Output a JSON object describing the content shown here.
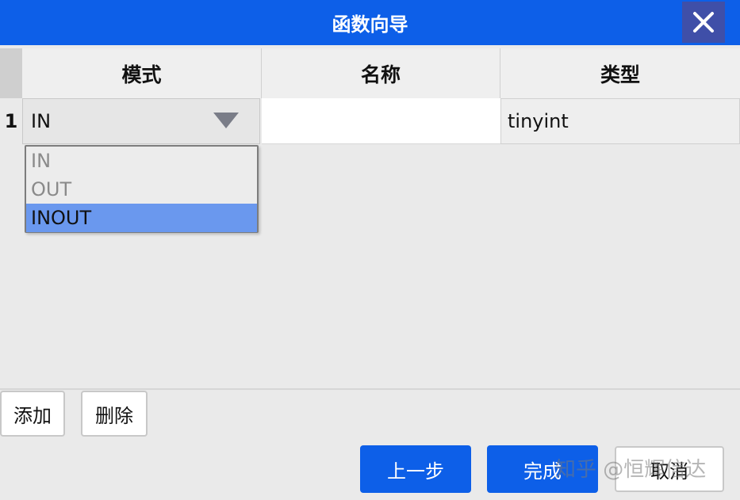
{
  "dialog": {
    "title": "函数向导",
    "close_icon": "close-icon"
  },
  "table": {
    "columns": [
      "模式",
      "名称",
      "类型"
    ],
    "rows": [
      {
        "index": "1",
        "mode": "IN",
        "name": "",
        "type": "tinyint"
      }
    ]
  },
  "mode_dropdown": {
    "options": [
      "IN",
      "OUT",
      "INOUT"
    ],
    "highlighted": "INOUT"
  },
  "buttons": {
    "add": "添加",
    "delete": "删除",
    "prev": "上一步",
    "finish": "完成",
    "cancel": "取消"
  },
  "watermark": "知乎 @恒辉信达",
  "colors": {
    "accent": "#0d5fe8",
    "highlight": "#6a98ee",
    "close_bg": "#3f4fa8"
  }
}
